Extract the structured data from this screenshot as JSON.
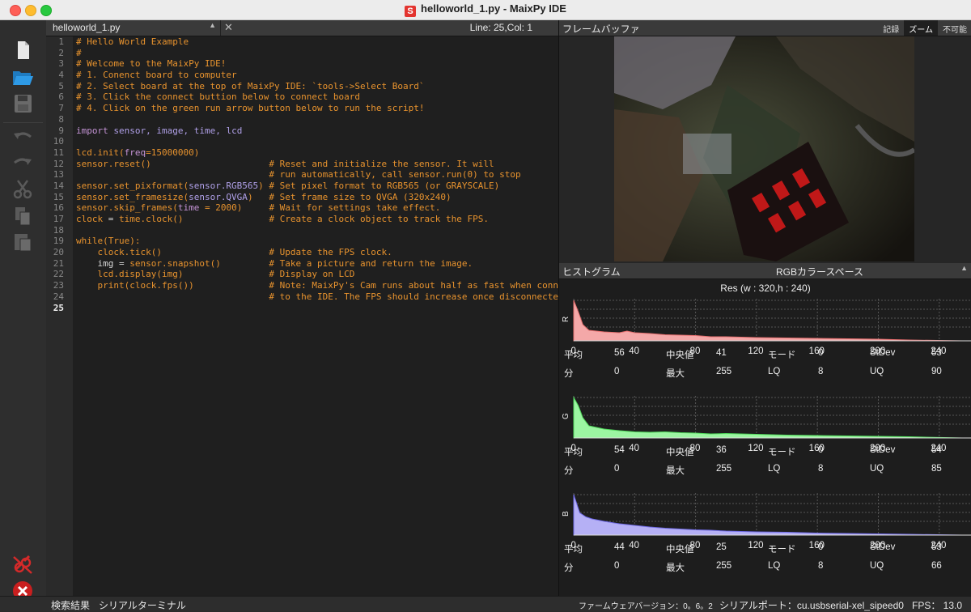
{
  "window": {
    "title": "helloworld_1.py - MaixPy IDE",
    "app_icon": "S"
  },
  "editor": {
    "file_name": "helloworld_1.py",
    "position": "Line: 25,Col: 1",
    "line_numbers": [
      "1",
      "2",
      "3",
      "4",
      "5",
      "6",
      "7",
      "8",
      "9",
      "10",
      "11",
      "12",
      "13",
      "14",
      "15",
      "16",
      "17",
      "18",
      "19",
      "20",
      "21",
      "22",
      "23",
      "24",
      "25"
    ],
    "lines": [
      [
        {
          "t": "# Hello World Example",
          "c": "com"
        }
      ],
      [
        {
          "t": "#",
          "c": "com"
        }
      ],
      [
        {
          "t": "# Welcome to the MaixPy IDE!",
          "c": "com"
        }
      ],
      [
        {
          "t": "# 1. Conenct board to computer",
          "c": "com"
        }
      ],
      [
        {
          "t": "# 2. Select board at the top of MaixPy IDE: `tools->Select Board`",
          "c": "com"
        }
      ],
      [
        {
          "t": "# 3. Click the connect buttion below to connect board",
          "c": "com"
        }
      ],
      [
        {
          "t": "# 4. Click on the green run arrow button below to run the script!",
          "c": "com"
        }
      ],
      [],
      [
        {
          "t": "import",
          "c": "kw"
        },
        {
          "t": " sensor, image, time, lcd",
          "c": "mod"
        }
      ],
      [],
      [
        {
          "t": "lcd.init(",
          "c": "nm"
        },
        {
          "t": "freq",
          "c": "kw"
        },
        {
          "t": "=15000000)",
          "c": "nm"
        }
      ],
      [
        {
          "t": "sensor.reset()",
          "c": "nm"
        },
        {
          "t": "                      # Reset and initialize the sensor. It will",
          "c": "com"
        }
      ],
      [
        {
          "t": "                                    # run automatically, call sensor.run(0) to stop",
          "c": "com"
        }
      ],
      [
        {
          "t": "sensor.set_pixformat(",
          "c": "nm"
        },
        {
          "t": "sensor.RGB565",
          "c": "mod"
        },
        {
          "t": ")",
          "c": "nm"
        },
        {
          "t": " # Set pixel format to RGB565 (or GRAYSCALE)",
          "c": "com"
        }
      ],
      [
        {
          "t": "sensor.set_framesize(",
          "c": "nm"
        },
        {
          "t": "sensor.QVGA",
          "c": "mod"
        },
        {
          "t": ")",
          "c": "nm"
        },
        {
          "t": "   # Set frame size to QVGA (320x240)",
          "c": "com"
        }
      ],
      [
        {
          "t": "sensor.skip_frames(",
          "c": "nm"
        },
        {
          "t": "time",
          "c": "kw"
        },
        {
          "t": " = 2000)",
          "c": "nm"
        },
        {
          "t": "     # Wait for settings take effect.",
          "c": "com"
        }
      ],
      [
        {
          "t": "clock",
          "c": "nm"
        },
        {
          "t": " = ",
          "c": "tx"
        },
        {
          "t": "time.clock()",
          "c": "nm"
        },
        {
          "t": "                # Create a clock object to track the FPS.",
          "c": "com"
        }
      ],
      [],
      [
        {
          "t": "while(True):",
          "c": "nm"
        }
      ],
      [
        {
          "t": "    clock.tick()",
          "c": "nm"
        },
        {
          "t": "                    # Update the FPS clock.",
          "c": "com"
        }
      ],
      [
        {
          "t": "    img",
          "c": "tx"
        },
        {
          "t": " = ",
          "c": "tx"
        },
        {
          "t": "sensor.snapshot()",
          "c": "nm"
        },
        {
          "t": "         # Take a picture and return the image.",
          "c": "com"
        }
      ],
      [
        {
          "t": "    lcd.display(img)",
          "c": "nm"
        },
        {
          "t": "                # Display on LCD",
          "c": "com"
        }
      ],
      [
        {
          "t": "    print(clock.fps())",
          "c": "nm"
        },
        {
          "t": "              # Note: MaixPy's Cam runs about half as fast when connected",
          "c": "com"
        }
      ],
      [
        {
          "t": "                                    # to the IDE. The FPS should increase once disconnected.",
          "c": "com"
        }
      ],
      []
    ]
  },
  "framebuffer": {
    "title": "フレームバッファ",
    "buttons": [
      "記録",
      "ズーム",
      "不可能"
    ]
  },
  "histogram": {
    "title": "ヒストグラム",
    "color_space": "RGBカラースペース",
    "resolution": "Res (w : 320,h : 240)",
    "x_ticks": [
      "0",
      "40",
      "80",
      "120",
      "160",
      "200",
      "240"
    ],
    "stat_labels": {
      "mean": "平均",
      "median": "中央値",
      "mode": "モード",
      "stdev": "StDev",
      "min": "分",
      "max": "最大",
      "lq": "LQ",
      "uq": "UQ"
    },
    "channels": [
      {
        "name": "R",
        "color": "#f4a8a8",
        "stroke": "#e56f6f",
        "mean": "56",
        "median": "41",
        "mode": "0",
        "stdev": "53",
        "min": "0",
        "max": "255",
        "lq": "8",
        "uq": "90",
        "curve": [
          [
            0,
            1
          ],
          [
            3,
            0.72
          ],
          [
            6,
            0.4
          ],
          [
            10,
            0.26
          ],
          [
            20,
            0.22
          ],
          [
            30,
            0.2
          ],
          [
            35,
            0.24
          ],
          [
            40,
            0.2
          ],
          [
            50,
            0.18
          ],
          [
            60,
            0.15
          ],
          [
            70,
            0.14
          ],
          [
            80,
            0.13
          ],
          [
            90,
            0.1
          ],
          [
            100,
            0.1
          ],
          [
            120,
            0.08
          ],
          [
            140,
            0.07
          ],
          [
            160,
            0.06
          ],
          [
            180,
            0.05
          ],
          [
            200,
            0.04
          ],
          [
            220,
            0.02
          ],
          [
            255,
            0.0
          ]
        ]
      },
      {
        "name": "G",
        "color": "#9cf5a2",
        "stroke": "#4fd85a",
        "mean": "54",
        "median": "36",
        "mode": "0",
        "stdev": "54",
        "min": "0",
        "max": "255",
        "lq": "8",
        "uq": "85",
        "curve": [
          [
            0,
            1
          ],
          [
            3,
            0.8
          ],
          [
            6,
            0.5
          ],
          [
            10,
            0.3
          ],
          [
            20,
            0.22
          ],
          [
            30,
            0.18
          ],
          [
            40,
            0.15
          ],
          [
            50,
            0.14
          ],
          [
            60,
            0.15
          ],
          [
            70,
            0.13
          ],
          [
            80,
            0.12
          ],
          [
            90,
            0.1
          ],
          [
            100,
            0.11
          ],
          [
            120,
            0.09
          ],
          [
            140,
            0.07
          ],
          [
            160,
            0.06
          ],
          [
            180,
            0.05
          ],
          [
            200,
            0.04
          ],
          [
            220,
            0.03
          ],
          [
            255,
            0.0
          ]
        ]
      },
      {
        "name": "B",
        "color": "#b5b0f5",
        "stroke": "#6f6ae6",
        "mean": "44",
        "median": "25",
        "mode": "0",
        "stdev": "53",
        "min": "0",
        "max": "255",
        "lq": "8",
        "uq": "66",
        "curve": [
          [
            0,
            1
          ],
          [
            4,
            0.55
          ],
          [
            8,
            0.45
          ],
          [
            12,
            0.4
          ],
          [
            20,
            0.34
          ],
          [
            30,
            0.28
          ],
          [
            40,
            0.24
          ],
          [
            50,
            0.2
          ],
          [
            60,
            0.17
          ],
          [
            70,
            0.15
          ],
          [
            80,
            0.13
          ],
          [
            90,
            0.12
          ],
          [
            100,
            0.1
          ],
          [
            120,
            0.08
          ],
          [
            140,
            0.07
          ],
          [
            160,
            0.05
          ],
          [
            180,
            0.04
          ],
          [
            200,
            0.03
          ],
          [
            220,
            0.02
          ],
          [
            255,
            0.0
          ]
        ]
      }
    ]
  },
  "status": {
    "search_results": "検索結果",
    "serial_terminal": "シリアルターミナル",
    "firmware": "ファームウェアバージョン：0。6。2",
    "serial_port": "シリアルポート：cu.usbserial-xel_sipeed0",
    "fps": "FPS：  13.0"
  }
}
